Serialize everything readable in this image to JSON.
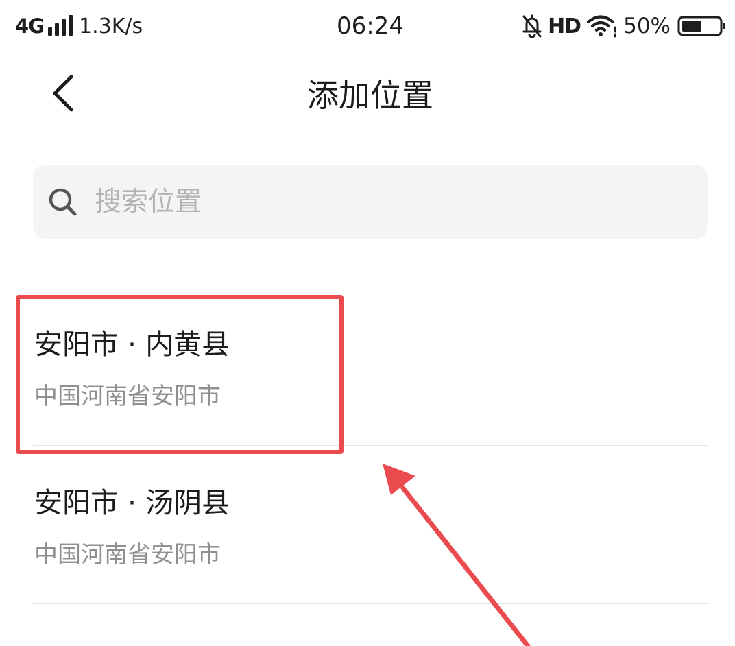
{
  "status_bar": {
    "network": "4G",
    "speed": "1.3K/s",
    "time": "06:24",
    "hd": "HD",
    "battery": "50%",
    "icons": [
      "signal-icon",
      "bell-off-icon",
      "wifi-icon",
      "battery-icon"
    ]
  },
  "header": {
    "back_icon": "chevron-left-icon",
    "title": "添加位置"
  },
  "search": {
    "icon": "search-icon",
    "placeholder": "搜索位置",
    "value": ""
  },
  "locations": [
    {
      "name": "安阳市 · 内黄县",
      "address": "中国河南省安阳市"
    },
    {
      "name": "安阳市 · 汤阴县",
      "address": "中国河南省安阳市"
    }
  ],
  "colors": {
    "annotation": "#e94b4f",
    "search_bg": "#f4f4f4",
    "secondary_text": "#8f8f8f",
    "divider": "#e6e6e6"
  }
}
